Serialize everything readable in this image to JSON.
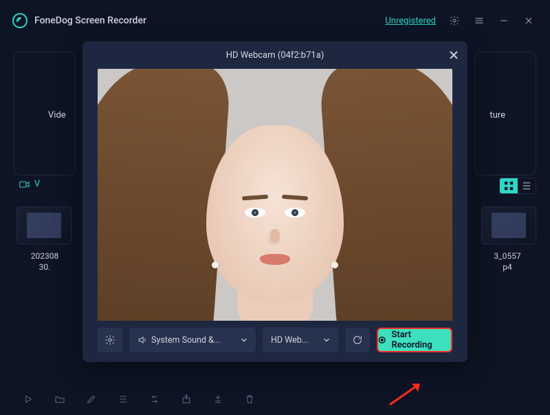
{
  "app": {
    "title": "FoneDog Screen Recorder",
    "status": "Unregistered"
  },
  "bg": {
    "left_label": "Vide",
    "right_label": "ture",
    "filter_label": "V",
    "file_left_line1": "202308",
    "file_left_line2": "30.",
    "file_right_line1": "3_0557",
    "file_right_line2": "p4"
  },
  "modal": {
    "title": "HD Webcam (04f2:b71a)",
    "audio_label": "System Sound &...",
    "cam_label": "HD Web...",
    "start_label": "Start Recording"
  },
  "icons": {
    "speaker": "speaker-icon",
    "chev": "chevron-down-icon"
  }
}
